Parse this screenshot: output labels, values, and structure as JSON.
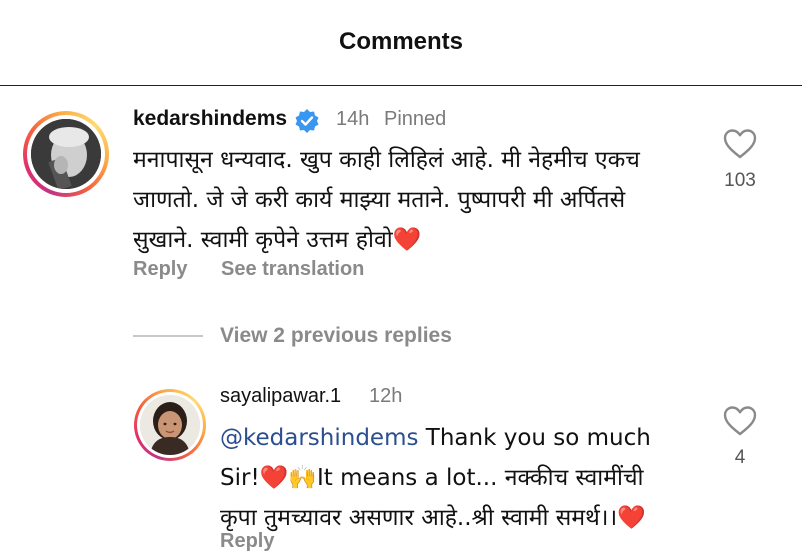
{
  "header": {
    "title": "Comments"
  },
  "comments": [
    {
      "username": "kedarshindems",
      "time": "14h",
      "pinned": "Pinned",
      "lines": [
        "मनापासून धन्यवाद. खुप काही लिहिलं आहे. मी नेहमीच एकच",
        "जाणतो. जे जे करी कार्य माझ्या मताने. पुष्पापरी मी अर्पितसे",
        "सुखाने. स्वामी कृपेने उत्तम होवो"
      ],
      "heart_emoji": "❤️",
      "likes": "103",
      "reply_label": "Reply",
      "translate_label": "See translation"
    }
  ],
  "view_replies": "View 2 previous replies",
  "replies": [
    {
      "username": "sayalipawar.1",
      "time": "12h",
      "mention": "@kedarshindems",
      "line1_rest": " Thank you so much",
      "line2_a": "Sir!",
      "line2_emoji1": "❤️",
      "line2_emoji2": "🙌",
      "line2_b": "It means a lot... नक्कीच स्वामींची",
      "line3": "कृपा तुमच्यावर असणार आहे..श्री स्वामी समर्थ।।",
      "line3_emoji": "❤️",
      "likes": "4",
      "reply_label": "Reply"
    }
  ]
}
